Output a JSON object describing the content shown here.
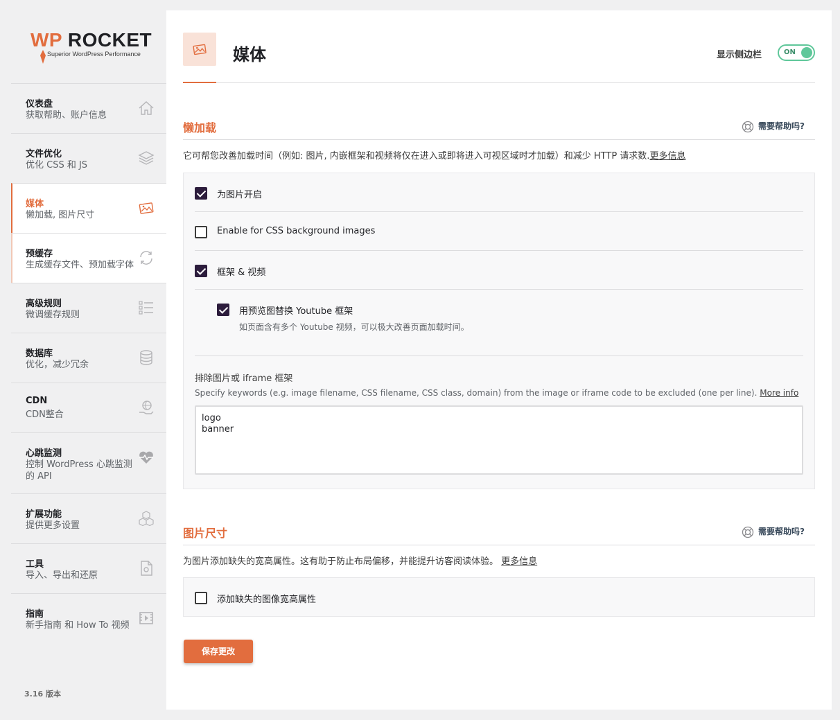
{
  "brand": {
    "logo_wp": "WP",
    "logo_rocket": "ROCKET",
    "tagline": "Superior WordPress Performance",
    "accent": "#e26d3e"
  },
  "sidebar": {
    "items": [
      {
        "title": "仪表盘",
        "sub": "获取帮助、账户信息",
        "icon": "home-icon"
      },
      {
        "title": "文件优化",
        "sub": "优化 CSS 和 JS",
        "icon": "layers-icon"
      },
      {
        "title": "媒体",
        "sub": "懒加载, 图片尺寸",
        "icon": "images-icon"
      },
      {
        "title": "预缓存",
        "sub": "生成缓存文件、预加载字体",
        "icon": "refresh-icon"
      },
      {
        "title": "高级规则",
        "sub": "微调缓存规则",
        "icon": "checklist-icon"
      },
      {
        "title": "数据库",
        "sub": "优化，减少冗余",
        "icon": "database-icon"
      },
      {
        "title": "CDN",
        "sub": "CDN整合",
        "icon": "globe-hand-icon"
      },
      {
        "title": "心跳监测",
        "sub": "控制 WordPress 心跳监测的 API",
        "icon": "heartbeat-icon"
      },
      {
        "title": "扩展功能",
        "sub": "提供更多设置",
        "icon": "cubes-icon"
      },
      {
        "title": "工具",
        "sub": "导入、导出和还原",
        "icon": "file-gear-icon"
      },
      {
        "title": "指南",
        "sub": "新手指南 和 How To 视频",
        "icon": "video-icon"
      }
    ],
    "version": "3.16 版本"
  },
  "header": {
    "title": "媒体",
    "sidebar_toggle_label": "显示侧边栏",
    "toggle_state": "ON"
  },
  "lazyload": {
    "title": "懒加载",
    "help": "需要帮助吗?",
    "desc": "它可帮您改善加载时间（例如: 图片, 内嵌框架和视频将仅在进入或即将进入可视区域时才加载）和减少 HTTP 请求数.",
    "desc_link": "更多信息",
    "options": {
      "images": "为图片开启",
      "css_bg": "Enable for CSS background images",
      "iframes": "框架 & 视频",
      "youtube": "用预览图替换 Youtube 框架",
      "youtube_desc": "如页面含有多个 Youtube 视频，可以极大改善页面加载时间。"
    },
    "exclude_label": "排除图片或 iframe 框架",
    "exclude_desc": "Specify keywords (e.g. image filename, CSS filename, CSS class, domain) from the image or iframe code to be excluded (one per line).",
    "exclude_link": "More info",
    "exclude_value": "logo\nbanner"
  },
  "dimensions": {
    "title": "图片尺寸",
    "help": "需要帮助吗?",
    "desc": "为图片添加缺失的宽高属性。这有助于防止布局偏移，并能提升访客阅读体验。",
    "desc_link": "更多信息",
    "option": "添加缺失的图像宽高属性"
  },
  "save_label": "保存更改"
}
